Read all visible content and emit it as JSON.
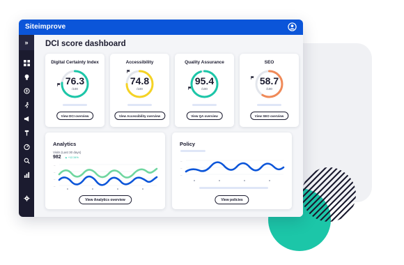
{
  "app": {
    "brand": "Siteimprove",
    "brand_color": "#0b55d9",
    "sidebar_color": "#1b1b2f"
  },
  "sidebar": {
    "toggle_label": "»",
    "items": [
      {
        "icon": "grid-icon"
      },
      {
        "icon": "lightbulb-icon"
      },
      {
        "icon": "accessibility-icon"
      },
      {
        "icon": "running-person-icon"
      },
      {
        "icon": "megaphone-icon"
      },
      {
        "icon": "hammer-icon"
      },
      {
        "icon": "speedometer-icon"
      },
      {
        "icon": "analytics-search-icon"
      },
      {
        "icon": "bar-chart-icon"
      },
      {
        "icon": "settings-icon"
      }
    ]
  },
  "page": {
    "title": "DCI score dashboard"
  },
  "score_cards": [
    {
      "title": "Digital Certainty Index",
      "value": "76.3",
      "max": "/100",
      "score": 76.3,
      "color": "#1cc6a8",
      "button": "View DCI overview"
    },
    {
      "title": "Accessibility",
      "value": "74.8",
      "max": "/100",
      "score": 74.8,
      "color": "#f5d324",
      "button": "View Accessibility overview"
    },
    {
      "title": "Quality Assurance",
      "value": "95.4",
      "max": "/100",
      "score": 95.4,
      "color": "#1cc6a8",
      "button": "View QA overview"
    },
    {
      "title": "SEO",
      "value": "58.7",
      "max": "/100",
      "score": 58.7,
      "color": "#f08a58",
      "button": "View SEO overview"
    }
  ],
  "analytics": {
    "title": "Analytics",
    "subtitle": "Visits (Last 30 days)",
    "visits": "982",
    "delta": "▲ +12.34%",
    "button": "View Analytics overview",
    "series_colors": {
      "primary": "#0b55d9",
      "secondary": "#6fd6a0"
    }
  },
  "policy": {
    "title": "Policy",
    "button": "View policies",
    "series_color": "#0b55d9"
  }
}
